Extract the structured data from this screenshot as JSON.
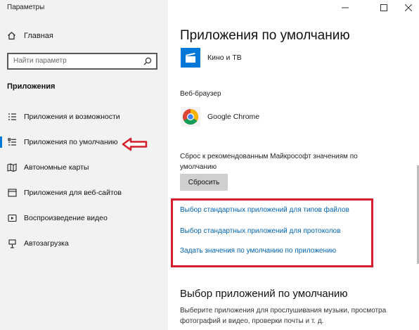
{
  "window": {
    "title": "Параметры",
    "controls": [
      "—",
      "☐",
      "✕"
    ]
  },
  "sidebar": {
    "home_label": "Главная",
    "search_placeholder": "Найти параметр",
    "section_title": "Приложения",
    "items": [
      {
        "label": "Приложения и возможности",
        "icon": "apps-list-icon"
      },
      {
        "label": "Приложения по умолчанию",
        "icon": "default-apps-icon",
        "active": true
      },
      {
        "label": "Автономные карты",
        "icon": "map-icon"
      },
      {
        "label": "Приложения для веб-сайтов",
        "icon": "web-apps-icon"
      },
      {
        "label": "Воспроизведение видео",
        "icon": "video-icon"
      },
      {
        "label": "Автозагрузка",
        "icon": "startup-icon"
      }
    ]
  },
  "main": {
    "title": "Приложения по умолчанию",
    "movies_app": "Кино и ТВ",
    "browser_label": "Веб-браузер",
    "browser_app": "Google Chrome",
    "reset_text": "Сброс к рекомендованным Майкрософт значениям по умолчанию",
    "reset_button": "Сбросить",
    "links": [
      "Выбор стандартных приложений для типов файлов",
      "Выбор стандартных приложений для протоколов",
      "Задать значения по умолчанию по приложению"
    ],
    "section2_title": "Выбор приложений по умолчанию",
    "section2_desc": "Выберите приложения для прослушивания музыки, просмотра фотографий и видео, проверки почты и т. д."
  },
  "colors": {
    "accent": "#0078d7",
    "link": "#0063b1",
    "highlight": "#d31f2c",
    "sidebar_bg": "#f2f2f2"
  }
}
